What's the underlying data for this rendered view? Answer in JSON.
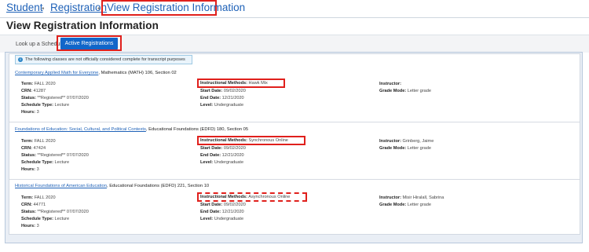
{
  "breadcrumb": {
    "items": [
      "Student",
      "Registration"
    ],
    "current": "View Registration Information"
  },
  "page_title": "View Registration Information",
  "tabs": {
    "lookup": "Look up a Schedule",
    "active": "Active Registrations"
  },
  "notice": "The following classes are not officially considered complete for transcript purposes",
  "labels": {
    "term": "Term:",
    "crn": "CRN:",
    "status": "Status:",
    "schedule_type": "Schedule Type:",
    "hours": "Hours:",
    "instructional_methods": "Instructional Methods:",
    "start_date": "Start Date:",
    "end_date": "End Date:",
    "level": "Level:",
    "instructor": "Instructor:",
    "grade_mode": "Grade Mode:"
  },
  "courses": [
    {
      "title": "Contemporary Applied Math for Everyone",
      "subtitle": ", Mathematics (MATH) 106, Section 02",
      "term": "FALL 2020",
      "crn": "41287",
      "status": "**Registered** 07/07/2020",
      "schedule_type": "Lecture",
      "hours": "3",
      "method": "Hawk Mix",
      "start_date": "09/02/2020",
      "end_date": "12/21/2020",
      "level": "Undergraduate",
      "instructor": "",
      "grade_mode": "Letter grade"
    },
    {
      "title": "Foundations of Education: Social, Cultural, and Political Contexts",
      "subtitle": ", Educational Foundations (EDFD) 180, Section 05",
      "term": "FALL 2020",
      "crn": "47424",
      "status": "**Registered** 07/07/2020",
      "schedule_type": "Lecture",
      "hours": "3",
      "method": "Synchronous Online",
      "start_date": "09/02/2020",
      "end_date": "12/21/2020",
      "level": "Undergraduate",
      "instructor": "Grinberg, Jaime",
      "grade_mode": "Letter grade"
    },
    {
      "title": "Historical Foundations of American Education",
      "subtitle": ", Educational Foundations (EDFD) 221, Section 10",
      "term": "FALL 2020",
      "crn": "44771",
      "status": "**Registered** 07/07/2020",
      "schedule_type": "Lecture",
      "hours": "3",
      "method": "Asynchronous Online",
      "start_date": "09/02/2020",
      "end_date": "12/21/2020",
      "level": "Undergraduate",
      "instructor": "Misir Hiralall, Sabrina",
      "grade_mode": "Letter grade"
    }
  ],
  "colors": {
    "link": "#1f62b8",
    "accent_button": "#1166c9",
    "highlight_box": "#e0201c"
  }
}
